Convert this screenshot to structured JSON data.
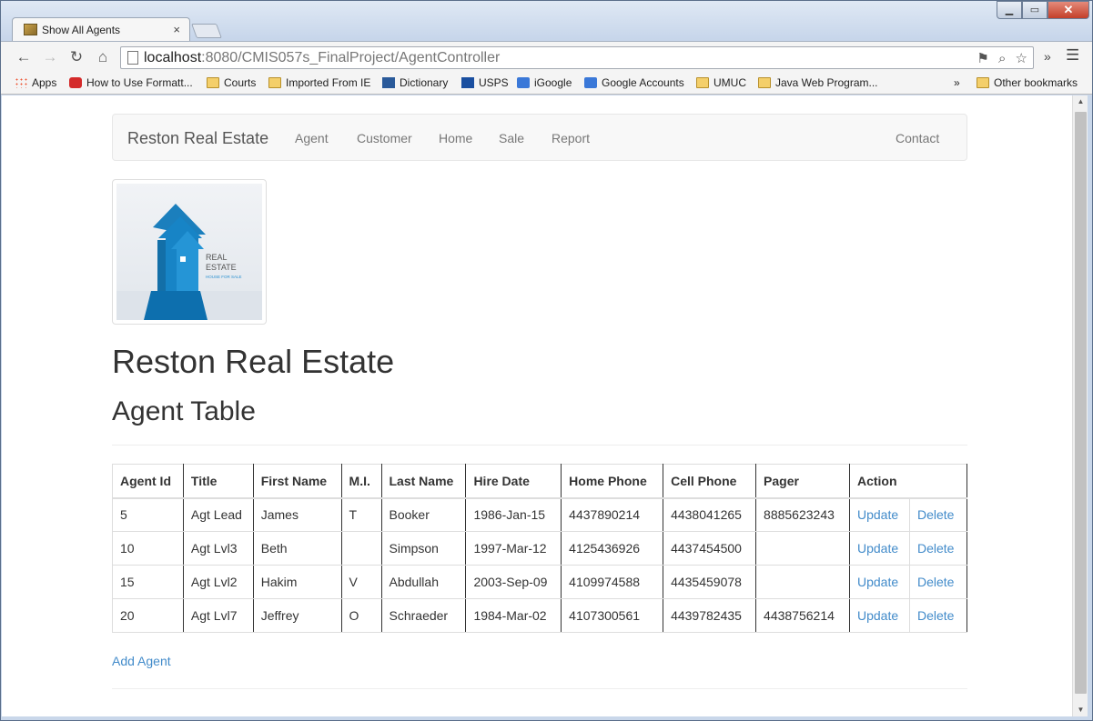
{
  "browser": {
    "tab_title": "Show All Agents",
    "tab_close": "×",
    "url_host": "localhost",
    "url_path": ":8080/CMIS057s_FinalProject/AgentController",
    "close_glyph": "✕",
    "min_glyph": "▁",
    "max_glyph": "▭"
  },
  "bookmarks": [
    {
      "label": "Apps",
      "icon": "apps-icon"
    },
    {
      "label": "How to Use Formatt...",
      "icon": "opera-icon"
    },
    {
      "label": "Courts",
      "icon": "folder-icon"
    },
    {
      "label": "Imported From IE",
      "icon": "folder-icon"
    },
    {
      "label": "Dictionary",
      "icon": "dictionary-icon"
    },
    {
      "label": "USPS",
      "icon": "usps-icon"
    },
    {
      "label": "iGoogle",
      "icon": "google-icon"
    },
    {
      "label": "Google Accounts",
      "icon": "google-icon"
    },
    {
      "label": "UMUC",
      "icon": "folder-icon"
    },
    {
      "label": "Java Web Program...",
      "icon": "folder-icon"
    }
  ],
  "bookmarks_overflow": "»",
  "other_bookmarks": "Other bookmarks",
  "navbar": {
    "brand": "Reston Real Estate",
    "links": [
      "Agent",
      "Customer",
      "Home",
      "Sale",
      "Report"
    ],
    "contact": "Contact"
  },
  "logo": {
    "line1": "REAL",
    "line2": "ESTATE",
    "line3": "HOUSE FOR SALE"
  },
  "page": {
    "title": "Reston Real Estate",
    "subtitle": "Agent Table",
    "add_link": "Add Agent"
  },
  "table": {
    "headers": [
      "Agent Id",
      "Title",
      "First Name",
      "M.I.",
      "Last Name",
      "Hire Date",
      "Home Phone",
      "Cell Phone",
      "Pager",
      "Action"
    ],
    "rows": [
      {
        "id": "5",
        "title": "Agt Lead",
        "first": "James",
        "mi": "T",
        "last": "Booker",
        "hire": "1986-Jan-15",
        "home": "4437890214",
        "cell": "4438041265",
        "pager": "8885623243",
        "update": "Update",
        "delete": "Delete"
      },
      {
        "id": "10",
        "title": "Agt Lvl3",
        "first": "Beth",
        "mi": "",
        "last": "Simpson",
        "hire": "1997-Mar-12",
        "home": "4125436926",
        "cell": "4437454500",
        "pager": "",
        "update": "Update",
        "delete": "Delete"
      },
      {
        "id": "15",
        "title": "Agt Lvl2",
        "first": "Hakim",
        "mi": "V",
        "last": "Abdullah",
        "hire": "2003-Sep-09",
        "home": "4109974588",
        "cell": "4435459078",
        "pager": "",
        "update": "Update",
        "delete": "Delete"
      },
      {
        "id": "20",
        "title": "Agt Lvl7",
        "first": "Jeffrey",
        "mi": "O",
        "last": "Schraeder",
        "hire": "1984-Mar-02",
        "home": "4107300561",
        "cell": "4439782435",
        "pager": "4438756214",
        "update": "Update",
        "delete": "Delete"
      }
    ]
  },
  "colors": {
    "link": "#428bca",
    "navbar_bg": "#f8f8f8",
    "brand_blue": "#1f7fc0"
  }
}
